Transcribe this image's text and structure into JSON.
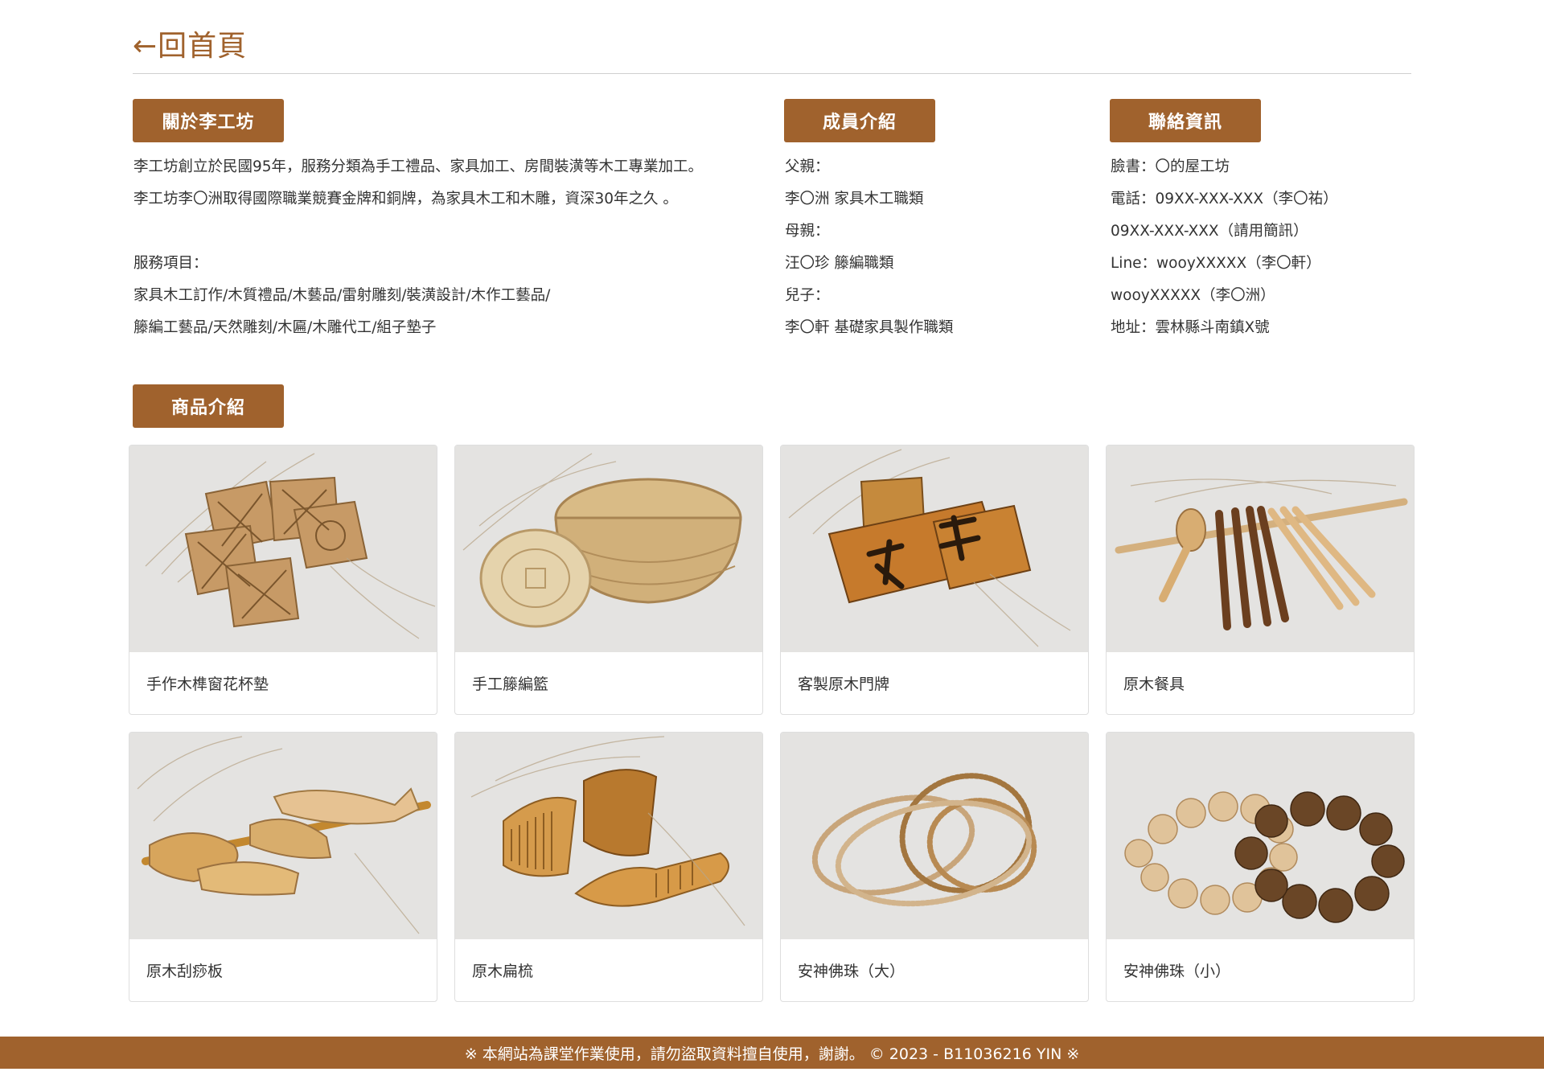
{
  "nav": {
    "back_label": "←回首頁"
  },
  "about": {
    "heading": "關於李工坊",
    "lines": [
      "李工坊創立於民國95年，服務分類為手工禮品、家具加工、房間裝潢等木工專業加工。",
      "李工坊李〇洲取得國際職業競賽金牌和銅牌，為家具木工和木雕，資深30年之久 。",
      "服務項目：",
      "家具木工訂作/木質禮品/木藝品/雷射雕刻/裝潢設計/木作工藝品/",
      "籐編工藝品/天然雕刻/木匾/木雕代工/組子墊子"
    ]
  },
  "members": {
    "heading": "成員介紹",
    "lines": [
      "父親：",
      "李〇洲 家具木工職類",
      "母親：",
      "汪〇珍 籐編職類",
      "兒子：",
      "李〇軒 基礎家具製作職類"
    ]
  },
  "contact": {
    "heading": "聯絡資訊",
    "lines": [
      "臉書：〇的屋工坊",
      "電話：09XX-XXX-XXX（李〇祐）",
      "09XX-XXX-XXX（請用簡訊）",
      "Line：wooyXXXXX（李〇軒）",
      "wooyXXXXX（李〇洲）",
      "地址：雲林縣斗南鎮X號"
    ]
  },
  "products": {
    "heading": "商品介紹",
    "items": [
      {
        "name": "手作木榫窗花杯墊"
      },
      {
        "name": "手工籐編籃"
      },
      {
        "name": "客製原木門牌"
      },
      {
        "name": "原木餐具"
      },
      {
        "name": "原木刮痧板"
      },
      {
        "name": "原木扁梳"
      },
      {
        "name": "安神佛珠（大）"
      },
      {
        "name": "安神佛珠（小）"
      }
    ]
  },
  "footer": {
    "text": "※ 本網站為課堂作業使用，請勿盜取資料擅自使用，謝謝。 © 2023 - B11036216 YIN ※"
  },
  "colors": {
    "accent": "#a0622d",
    "text": "#333333",
    "photo_bg": "#e6e6e6"
  }
}
